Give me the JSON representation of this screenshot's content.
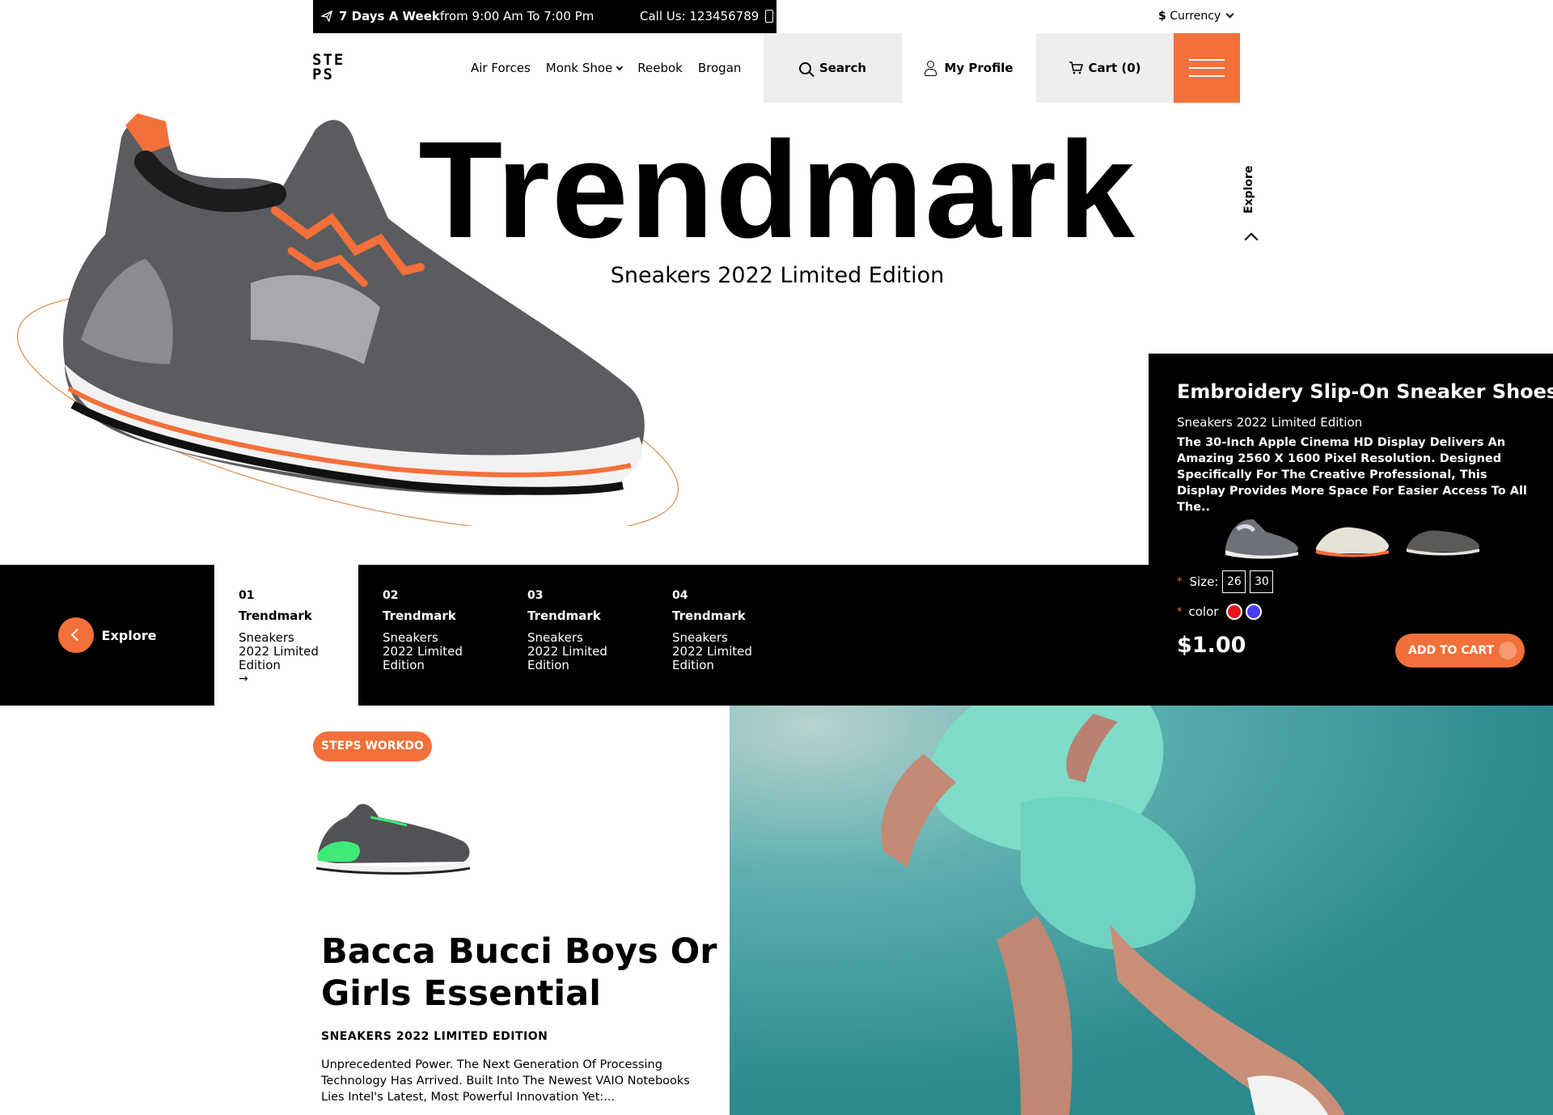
{
  "topbar": {
    "hours_bold": "7 Days A Week",
    "hours_rest": "from 9:00 Am To 7:00 Pm",
    "call": "Call Us: 123456789"
  },
  "currency": {
    "symbol": "$",
    "label": "Currency"
  },
  "logo": {
    "line1": "STE",
    "line2": "PS"
  },
  "nav": {
    "items": [
      "Air Forces",
      "Monk Shoe",
      "Reebok",
      "Brogan"
    ]
  },
  "header": {
    "search_label": "Search",
    "profile_label": "My Profile",
    "cart_label": "Cart",
    "cart_count": "(0)"
  },
  "hero": {
    "title": "Trendmark",
    "subtitle": "Sneakers 2022 Limited Edition",
    "explore": "Explore"
  },
  "product": {
    "title": "Embroidery Slip-On Sneaker Shoes",
    "subtitle": "Sneakers 2022 Limited Edition",
    "description": "The 30-Inch Apple Cinema HD Display Delivers An Amazing 2560 X 1600 Pixel Resolution. Designed Specifically For The Creative Professional, This Display Provides More Space For Easier Access To All The..",
    "size_label": "Size:",
    "sizes": [
      "26",
      "30"
    ],
    "color_label": "color",
    "colors": [
      "#e8161b",
      "#4a3cf0"
    ],
    "required_mark": "*",
    "price": "$1.00",
    "add_to_cart": "ADD TO CART"
  },
  "strip": {
    "explore_label": "Explore",
    "slides": [
      {
        "num": "01",
        "title": "Trendmark",
        "desc": "Sneakers 2022 Limited Edition",
        "arrow": "→"
      },
      {
        "num": "02",
        "title": "Trendmark",
        "desc": "Sneakers 2022 Limited Edition"
      },
      {
        "num": "03",
        "title": "Trendmark",
        "desc": "Sneakers 2022 Limited Edition"
      },
      {
        "num": "04",
        "title": "Trendmark",
        "desc": "Sneakers 2022 Limited Edition"
      }
    ]
  },
  "lower": {
    "badge": "STEPS WORKDO",
    "title": "Bacca Bucci Boys Or Girls Essential",
    "subtitle": "SNEAKERS 2022 LIMITED EDITION",
    "description": "Unprecedented Power. The Next Generation Of Processing Technology Has Arrived. Built Into The Newest VAIO Notebooks Lies Intel's Latest, Most Powerful Innovation Yet:..."
  },
  "colors": {
    "accent": "#f3703a",
    "dark": "#000000",
    "button_gray": "#eeeeee"
  }
}
